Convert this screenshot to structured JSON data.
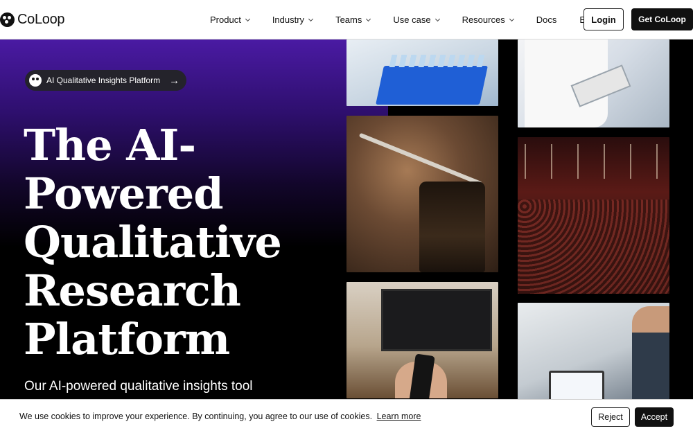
{
  "brand": {
    "name": "CoLoop"
  },
  "nav": {
    "items": [
      {
        "label": "Product",
        "dropdown": true
      },
      {
        "label": "Industry",
        "dropdown": true
      },
      {
        "label": "Teams",
        "dropdown": true
      },
      {
        "label": "Use case",
        "dropdown": true
      },
      {
        "label": "Resources",
        "dropdown": true
      },
      {
        "label": "Docs",
        "dropdown": false
      },
      {
        "label": "Blog",
        "dropdown": false
      }
    ],
    "login_label": "Login",
    "cta_label": "Get CoLoop"
  },
  "hero": {
    "badge_label": "AI Qualitative Insights Platform",
    "title_lines": [
      "The AI-",
      "Powered",
      "Qualitative",
      "Research",
      "Platform"
    ],
    "subtitle": "Our AI-powered qualitative insights tool"
  },
  "images": [
    {
      "subject": "lab-test-tubes"
    },
    {
      "subject": "coffee-tasting"
    },
    {
      "subject": "tv-remote"
    },
    {
      "subject": "doctors-clipboard"
    },
    {
      "subject": "theater-audience"
    },
    {
      "subject": "office-laptop"
    }
  ],
  "cookie": {
    "message": "We use cookies to improve your experience. By continuing, you agree to our use of cookies.",
    "link_label": "Learn more",
    "reject_label": "Reject",
    "accept_label": "Accept"
  },
  "colors": {
    "accent": "#4a1aa3",
    "dark": "#111111",
    "background": "#000000"
  }
}
